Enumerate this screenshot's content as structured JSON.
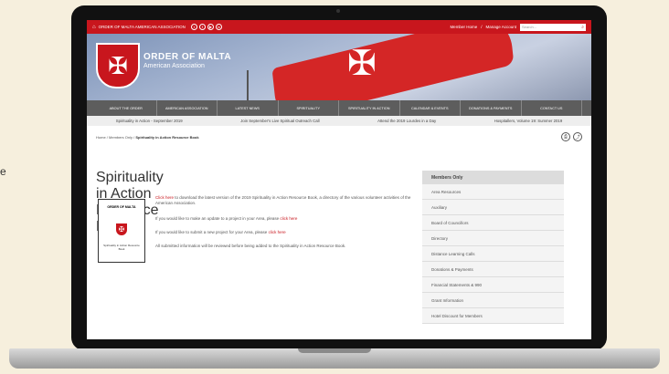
{
  "topbar": {
    "site_name": "ORDER OF MALTA AMERICAN ASSOCIATION",
    "social_icons": [
      "twitter-icon",
      "facebook-icon",
      "youtube-icon",
      "linkedin-icon"
    ],
    "member_home": "Member Home",
    "separator": "/",
    "manage_account": "Manage Account",
    "search_placeholder": "Search..."
  },
  "hero": {
    "brand_line1": "ORDER OF MALTA",
    "brand_line2": "American Association"
  },
  "nav": [
    "ABOUT THE ORDER",
    "AMERICAN ASSOCIATION",
    "LATEST NEWS",
    "SPIRITUALITY",
    "SPIRITUALITY IN ACTION",
    "CALENDAR & EVENTS",
    "DONATIONS & PAYMENTS",
    "CONTACT US"
  ],
  "ticker": [
    "Spirituality in Action - September 2019",
    "Join September's Live Spiritual Outreach Call",
    "Attend the 2019 Lourdes in a Day",
    "Hospitallers, Volume 19: Summer 2019"
  ],
  "breadcrumb": {
    "home": "Home",
    "members": "Members Only",
    "current": "Spirituality in Action Resource Book"
  },
  "main": {
    "title": "Spirituality in Action Resource Book",
    "p1_link": "Click here",
    "p1_text": " to download the latest version of the 2019 Spirituality in Action Resource Book, a directory of the various volunteer activities of the American Association.",
    "p2_text": "If you would like to make an update to a project in your Area, please ",
    "p2_link": "click here",
    "p3_text": "If you would like to submit a new project for your Area, please ",
    "p3_link": "click here",
    "p4_text": "All submitted information will be reviewed before being added to the Spirituality in Action Resource Book.",
    "book_title": "ORDER OF MALTA",
    "book_footer": "Spirituality in Action Resource Book"
  },
  "sidebar": {
    "header": "Members Only",
    "items": [
      "Area Resources",
      "Auxiliary",
      "Board of Councillors",
      "Directory",
      "Distance Learning Calls",
      "Donations & Payments",
      "Financial Statements & 990",
      "Grant Information",
      "Hotel Discount for Members"
    ]
  },
  "stray_text": "e"
}
